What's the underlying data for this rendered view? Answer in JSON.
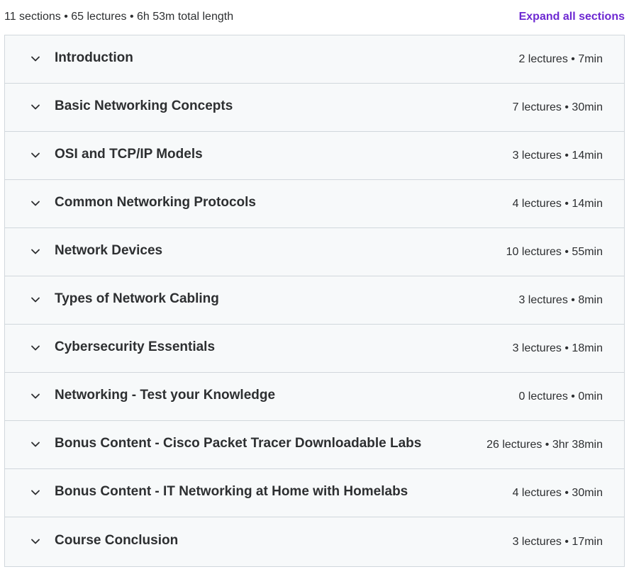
{
  "summary": {
    "text": "11 sections • 65 lectures • 6h 53m total length",
    "expand_all_label": "Expand all sections"
  },
  "colors": {
    "accent": "#6d28d2",
    "section_bg": "#f7f9fa",
    "border": "#d1d7dc",
    "text": "#2d2f31"
  },
  "sections": [
    {
      "title": "Introduction",
      "meta": "2 lectures • 7min"
    },
    {
      "title": "Basic Networking Concepts",
      "meta": "7 lectures • 30min"
    },
    {
      "title": "OSI and TCP/IP Models",
      "meta": "3 lectures • 14min"
    },
    {
      "title": "Common Networking Protocols",
      "meta": "4 lectures • 14min"
    },
    {
      "title": "Network Devices",
      "meta": "10 lectures • 55min"
    },
    {
      "title": "Types of Network Cabling",
      "meta": "3 lectures • 8min"
    },
    {
      "title": "Cybersecurity Essentials",
      "meta": "3 lectures • 18min"
    },
    {
      "title": "Networking - Test your Knowledge",
      "meta": "0 lectures • 0min"
    },
    {
      "title": "Bonus Content - Cisco Packet Tracer Downloadable Labs",
      "meta": "26 lectures • 3hr 38min"
    },
    {
      "title": "Bonus Content - IT Networking at Home with Homelabs",
      "meta": "4 lectures • 30min"
    },
    {
      "title": "Course Conclusion",
      "meta": "3 lectures • 17min"
    }
  ]
}
